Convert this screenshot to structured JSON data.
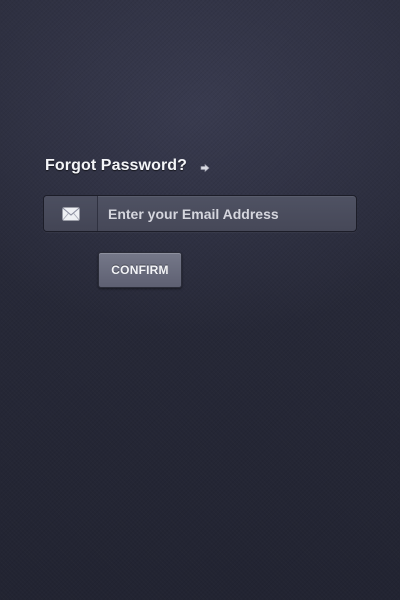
{
  "form": {
    "title": "Forgot Password?",
    "email_placeholder": "Enter your Email Address",
    "email_value": "",
    "confirm_label": "CONFIRM"
  },
  "icons": {
    "heading": "arrow-right-icon",
    "email": "envelope-icon"
  },
  "colors": {
    "background": "#262837",
    "field": "#4b4d5e",
    "button": "#6a6c7e",
    "text": "#f4f5f8"
  }
}
